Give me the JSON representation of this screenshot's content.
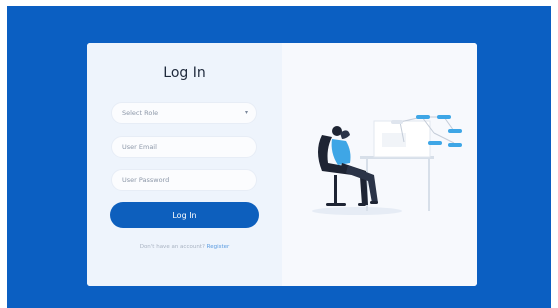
{
  "login": {
    "title": "Log In",
    "role_select": {
      "value": "Select Role"
    },
    "email": {
      "placeholder": "User Email"
    },
    "password": {
      "placeholder": "User Password"
    },
    "submit_label": "Log In",
    "register_prompt": "Don't have an account?",
    "register_link": "Register"
  },
  "colors": {
    "background": "#0b5fc2",
    "primary_button": "#0d5fbd",
    "accent": "#3ea6e6"
  },
  "icons": [
    "chevron-down-icon",
    "person-at-desk-illustration"
  ]
}
